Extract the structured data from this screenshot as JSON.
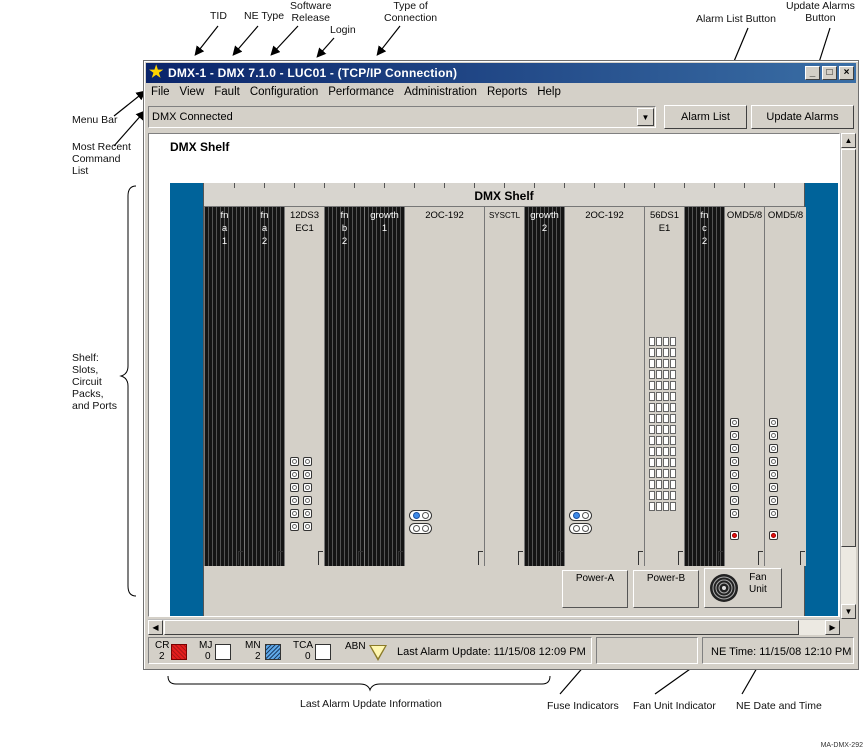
{
  "callouts": {
    "tid": "TID",
    "ne_type": "NE Type",
    "software_release": "Software\nRelease",
    "login": "Login",
    "type_of_connection": "Type of\nConnection",
    "alarm_list_button": "Alarm List Button",
    "update_alarms_button": "Update Alarms\nButton",
    "menu_bar": "Menu Bar",
    "most_recent_command_list": "Most Recent\nCommand\nList",
    "shelf": "Shelf:\nSlots,\nCircuit\nPacks,\nand Ports",
    "last_alarm_update_information": "Last Alarm Update Information",
    "fuse_indicators": "Fuse Indicators",
    "fan_unit_indicator": "Fan Unit Indicator",
    "ne_date_and_time": "NE Date and Time",
    "figure_id": "MA-DMX-292"
  },
  "window": {
    "title": "DMX-1 - DMX 7.1.0 - LUC01 - (TCP/IP Connection)",
    "controls": {
      "minimize": "_",
      "maximize": "□",
      "close": "×"
    }
  },
  "menu": [
    "File",
    "View",
    "Fault",
    "Configuration",
    "Performance",
    "Administration",
    "Reports",
    "Help"
  ],
  "command_list": {
    "value": "DMX Connected",
    "arrow": "▼"
  },
  "buttons": {
    "alarm_list": "Alarm List",
    "update_alarms": "Update Alarms"
  },
  "canvas": {
    "title": "DMX Shelf"
  },
  "shelf": {
    "header": "DMX Shelf",
    "slots": [
      {
        "label": "fn\na\n1",
        "kind": "fan"
      },
      {
        "label": "fn\na\n2",
        "kind": "fan"
      },
      {
        "label": "12DS3\nEC1",
        "kind": "card"
      },
      {
        "label": "fn\nb\n2",
        "kind": "fan"
      },
      {
        "label": "growth\n1",
        "kind": "fan"
      },
      {
        "label": "2OC-192",
        "kind": "card"
      },
      {
        "label": "SYSCTL",
        "kind": "card"
      },
      {
        "label": "growth\n2",
        "kind": "fan"
      },
      {
        "label": "2OC-192",
        "kind": "card"
      },
      {
        "label": "56DS1\nE1",
        "kind": "card"
      },
      {
        "label": "fn\nc\n2",
        "kind": "fan"
      },
      {
        "label": "OMD5/8",
        "kind": "card"
      },
      {
        "label": "OMD5/8",
        "kind": "card"
      }
    ],
    "power_a": "Power-A",
    "power_b": "Power-B",
    "fan_unit": "Fan\nUnit"
  },
  "status": {
    "cr_label": "CR",
    "cr_count": "2",
    "mj_label": "MJ",
    "mj_count": "0",
    "mn_label": "MN",
    "mn_count": "2",
    "tca_label": "TCA",
    "tca_count": "0",
    "abn_label": "ABN",
    "last_alarm_update": "Last Alarm Update: 11/15/08 12:09 PM",
    "ne_time": "NE Time: 11/15/08 12:10 PM"
  },
  "colors": {
    "titlebar_start": "#0a246a",
    "titlebar_end": "#3a6ea5",
    "shelf_rail": "#00639a",
    "critical": "#e51d1d",
    "minor": "#5fa9e8"
  }
}
